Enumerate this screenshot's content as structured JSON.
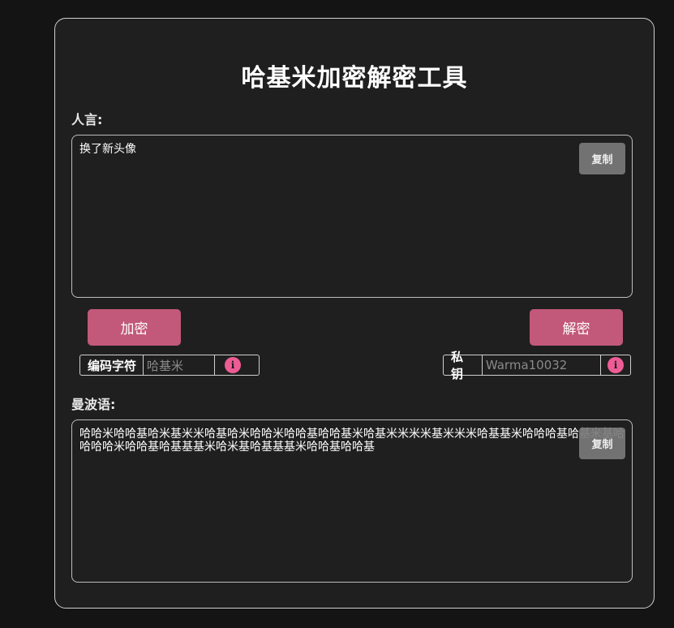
{
  "title": "哈基米加密解密工具",
  "human": {
    "label": "人言:",
    "text": "换了新头像",
    "copy_label": "复制"
  },
  "actions": {
    "encrypt_label": "加密",
    "decrypt_label": "解密"
  },
  "options": {
    "charset_label": "编码字符",
    "charset_placeholder": "哈基米",
    "key_label": "私钥",
    "key_placeholder": "Warma10032",
    "info_icon": "info-icon"
  },
  "cipher": {
    "label": "曼波语:",
    "text": "哈哈米哈哈基哈米基米米哈基哈米哈哈米哈哈基哈哈基米哈基米米米米基米米米哈基基米哈哈哈基哈基米基哈哈哈哈米哈哈基哈基基基米哈米基哈基基基米哈哈基哈哈基",
    "copy_label": "复制"
  },
  "colors": {
    "accent": "#c2587a",
    "info": "#ee5c95",
    "copy_button": "#7a7a7a",
    "panel_bg": "#1f1f1f",
    "page_bg": "#141414"
  }
}
